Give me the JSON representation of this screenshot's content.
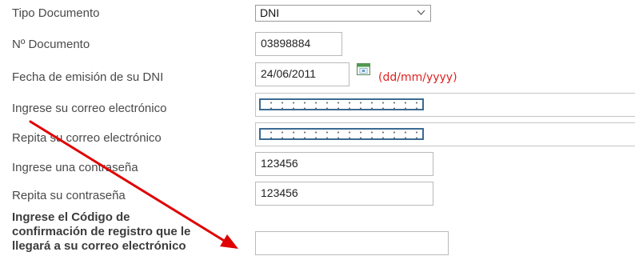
{
  "form": {
    "tipo_documento": {
      "label": "Tipo Documento",
      "value": "DNI"
    },
    "numero_documento": {
      "label": "Nº Documento",
      "value": "03898884"
    },
    "fecha_emision": {
      "label": "Fecha de emisión de su DNI",
      "value": "24/06/2011",
      "format_hint": "(dd/mm/yyyy)"
    },
    "correo": {
      "label": "Ingrese su correo electrónico"
    },
    "repetir_correo": {
      "label": "Repita su correo electrónico"
    },
    "contrasena": {
      "label": "Ingrese una contraseña",
      "value": "123456"
    },
    "repetir_contrasena": {
      "label": "Repita su contraseña",
      "value": "123456"
    },
    "codigo_confirmacion": {
      "label": "Ingrese el Código de confirmación de registro que le llegará a su correo electrónico",
      "value": ""
    }
  },
  "icons": {
    "select_chevron": "chevron-down-icon",
    "date_picker": "calendar-icon",
    "annotation": "red-arrow"
  },
  "colors": {
    "date_hint": "#e02020",
    "arrow": "#e00000",
    "email_mask_border": "#3b6a93"
  }
}
